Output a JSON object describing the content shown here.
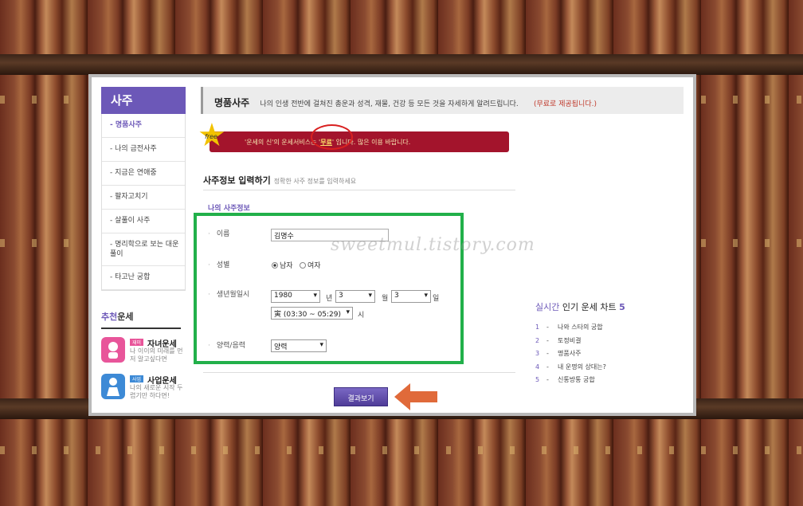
{
  "sidebar": {
    "title": "사주",
    "items": [
      {
        "label": "- 명품사주"
      },
      {
        "label": "- 나의 금전사주"
      },
      {
        "label": "- 지금은 연애중"
      },
      {
        "label": "- 팔자고치기"
      },
      {
        "label": "- 살풀이 사주"
      },
      {
        "label": "- 명리학으로 보는 대운풀이"
      },
      {
        "label": "- 타고난 궁합"
      }
    ],
    "recommend": {
      "title_a": "추천",
      "title_b": "운세",
      "items": [
        {
          "badge": "재미",
          "name": "자녀운세",
          "desc": "나 이이의 미래를 먼저 알고싶다면"
        },
        {
          "badge": "사업",
          "name": "사업운세",
          "desc": "나의 새로운 시작 두렵기만 하다면!"
        }
      ]
    }
  },
  "header": {
    "title": "명품사주",
    "desc": "나의 인생 전반에 걸쳐진 총운과 성격, 재물, 건강 등 모든 것을 자세하게 알려드립니다.",
    "free_note": "(무료로 제공됩니다.)"
  },
  "banner": {
    "free_label": "free",
    "text_a": "'운세의 신'의 운세서비스는 '",
    "text_free": "무료",
    "text_b": "' 입니다. 많은 이용 바랍니다."
  },
  "section": {
    "title": "사주정보 입력하기",
    "hint": "정확한 사주 정보를 입력하세요",
    "sub_title": "나의 사주정보"
  },
  "form": {
    "name_label": "이름",
    "name_value": "김명수",
    "gender_label": "성별",
    "gender_male": "남자",
    "gender_female": "여자",
    "birth_label": "생년월일시",
    "year": "1980",
    "year_unit": "년",
    "month": "3",
    "month_unit": "월",
    "day": "3",
    "day_unit": "일",
    "hour": "寅 (03:30 ~ 05:29)",
    "hour_unit": "시",
    "calendar_label": "양력/음력",
    "calendar_value": "양력",
    "submit_label": "결과보기"
  },
  "watermark": "sweetmul.tistory.com",
  "ranking": {
    "title_a": "실시간",
    "title_b": " 인기 운세 차트 ",
    "title_n": "5",
    "items": [
      {
        "num": "1",
        "label": "나와 스타의 궁합"
      },
      {
        "num": "2",
        "label": "토정비결"
      },
      {
        "num": "3",
        "label": "명품사주"
      },
      {
        "num": "4",
        "label": "내 운명의 상대는?"
      },
      {
        "num": "5",
        "label": "신통방통 궁합"
      }
    ]
  },
  "colors": {
    "accent": "#6c58b8",
    "highlight_box": "#22b04a",
    "banner": "#a3142c",
    "arrow": "#e06a3a"
  }
}
